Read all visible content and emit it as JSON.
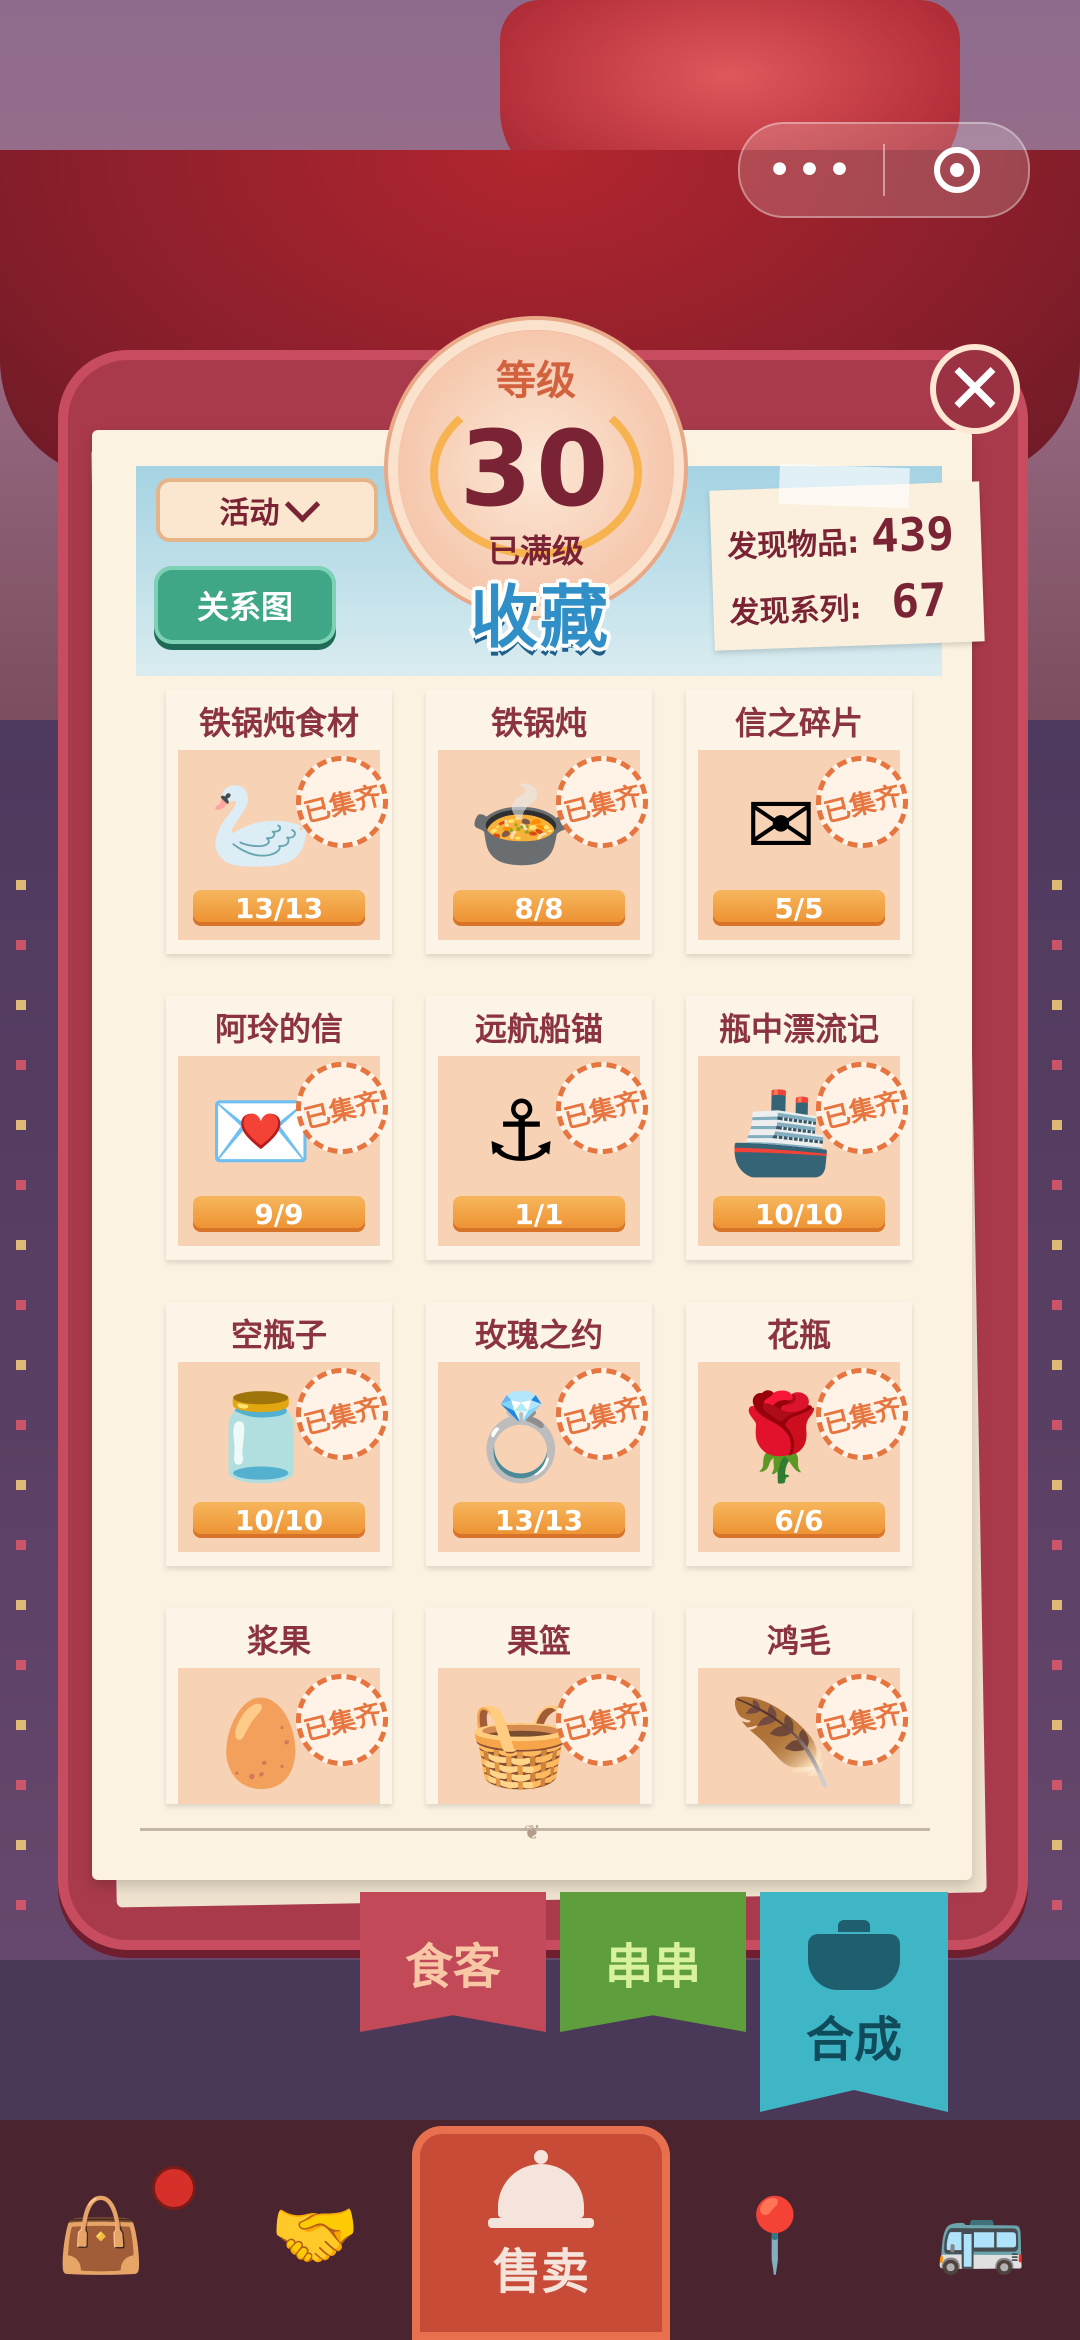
{
  "capsule": {
    "more_icon": "more-dots-icon",
    "more_label": "•••",
    "close_icon": "target-icon"
  },
  "level": {
    "label": "等级",
    "value": "30",
    "status": "已满级"
  },
  "title": "收藏",
  "filter": {
    "selected": "活动"
  },
  "relation_button": "关系图",
  "stats": {
    "items_label": "发现物品:",
    "items_value": "439",
    "series_label": "发现系列:",
    "series_value": "67"
  },
  "close_label": "✕",
  "stamp_text": "已集齐",
  "collections": [
    {
      "name": "铁锅炖食材",
      "progress": "13/13",
      "icon": "goose-icon",
      "glyph": "🦢"
    },
    {
      "name": "铁锅炖",
      "progress": "8/8",
      "icon": "stew-pot-icon",
      "glyph": "🍲"
    },
    {
      "name": "信之碎片",
      "progress": "5/5",
      "icon": "letter-pieces-icon",
      "glyph": "✉"
    },
    {
      "name": "阿玲的信",
      "progress": "9/9",
      "icon": "sealed-letter-icon",
      "glyph": "💌"
    },
    {
      "name": "远航船锚",
      "progress": "1/1",
      "icon": "anchor-icon",
      "glyph": "⚓"
    },
    {
      "name": "瓶中漂流记",
      "progress": "10/10",
      "icon": "ship-bottle-icon",
      "glyph": "🚢"
    },
    {
      "name": "空瓶子",
      "progress": "10/10",
      "icon": "empty-bottle-icon",
      "glyph": "🫙"
    },
    {
      "name": "玫瑰之约",
      "progress": "13/13",
      "icon": "ring-icon",
      "glyph": "💍"
    },
    {
      "name": "花瓶",
      "progress": "6/6",
      "icon": "rose-vase-icon",
      "glyph": "🌹"
    },
    {
      "name": "浆果",
      "progress": "",
      "icon": "angel-egg-icon",
      "glyph": "🥚"
    },
    {
      "name": "果篮",
      "progress": "",
      "icon": "fruit-basket-icon",
      "glyph": "🧺"
    },
    {
      "name": "鸿毛",
      "progress": "",
      "icon": "feather-icon",
      "glyph": "🪶"
    }
  ],
  "tabs": {
    "diners": "食客",
    "skewers": "串串",
    "craft": "合成"
  },
  "nav": {
    "sell": "售卖",
    "icons": [
      "bag-icon",
      "handshake-icon",
      "sell-bell-icon",
      "map-pin-icon",
      "bus-icon"
    ]
  }
}
